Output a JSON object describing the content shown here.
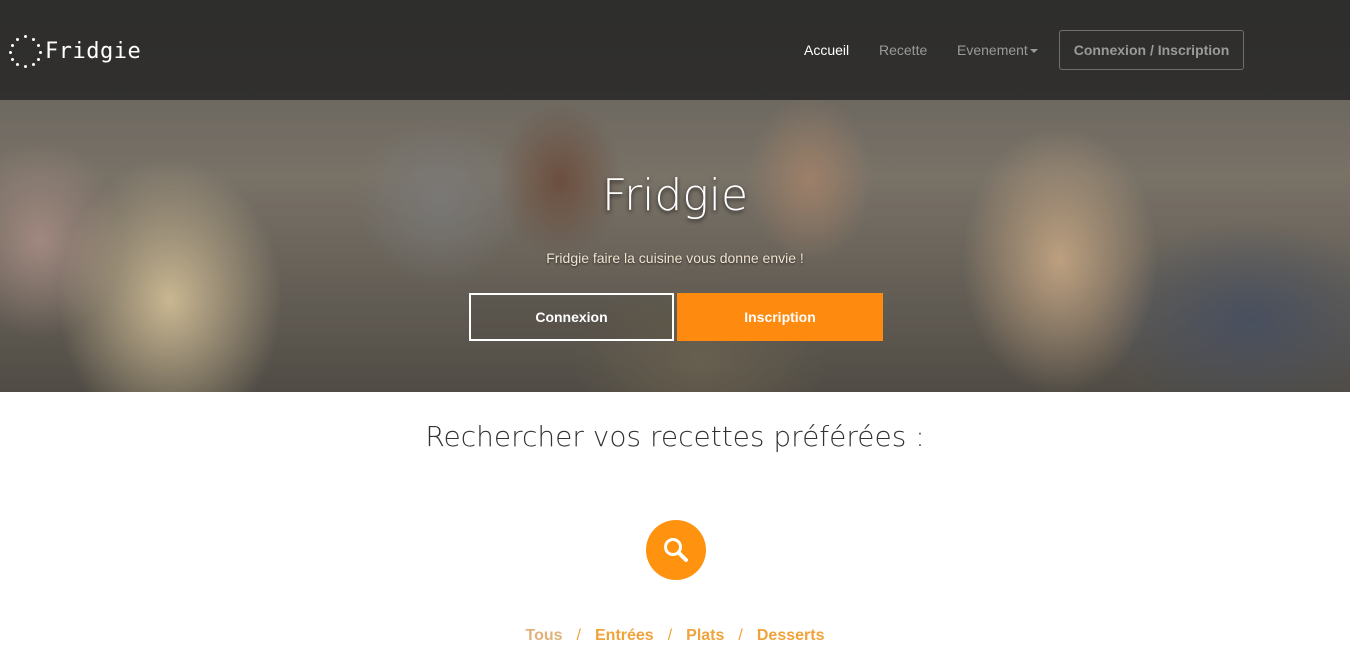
{
  "brand": {
    "name": "Fridgie",
    "icon": "dotted-circle-logo-icon"
  },
  "nav": {
    "items": [
      {
        "label": "Accueil",
        "active": true
      },
      {
        "label": "Recette",
        "active": false
      },
      {
        "label": "Evenement",
        "active": false,
        "dropdown": true
      }
    ],
    "auth_button": "Connexion / Inscription"
  },
  "hero": {
    "title": "Fridgie",
    "subtitle": "Fridgie faire la cuisine vous donne envie !",
    "buttons": {
      "connexion": "Connexion",
      "inscription": "Inscription"
    }
  },
  "search": {
    "title": "Rechercher vos recettes préférées :",
    "icon": "search-icon",
    "filters": [
      {
        "label": "Tous",
        "active": true
      },
      {
        "label": "Entrées",
        "active": false
      },
      {
        "label": "Plats",
        "active": false
      },
      {
        "label": "Desserts",
        "active": false
      }
    ],
    "separator": "/"
  },
  "colors": {
    "accent": "#ff8a10",
    "navbar": "#232323",
    "filter": "#f0a33a"
  }
}
